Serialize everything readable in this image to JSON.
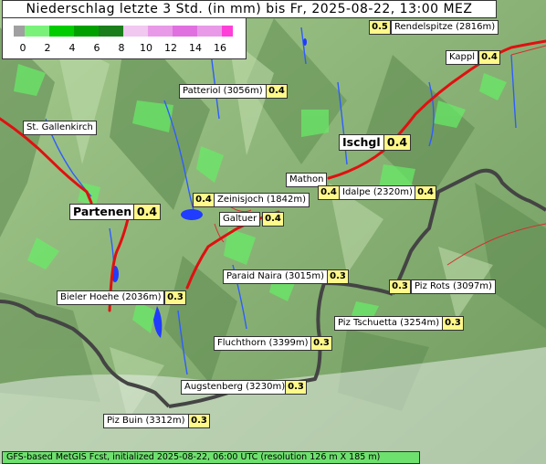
{
  "title": "Niederschlag letzte 3 Std. (in mm) bis Fr, 2025-08-22, 13:00 MEZ",
  "legend": {
    "ticks": [
      "0",
      "2",
      "4",
      "6",
      "8",
      "10",
      "12",
      "14",
      "16"
    ],
    "colors": [
      "#a0a0a0",
      "#7af27a",
      "#00cc00",
      "#00a000",
      "#1a7f1a",
      "#f0c8f0",
      "#e89ae8",
      "#e070e0",
      "#ff3fd8"
    ]
  },
  "places": [
    {
      "name": "Rendelspitze (2816m)",
      "value": "0.5"
    },
    {
      "name": "Kappl",
      "value": "0.4"
    },
    {
      "name": "Patteriol (3056m)",
      "value": "0.4"
    },
    {
      "name": "St. Gallenkirch",
      "value": ""
    },
    {
      "name": "Ischgl",
      "value": "0.4"
    },
    {
      "name": "Mathon",
      "value": "0.4"
    },
    {
      "name": "Idalpe (2320m)",
      "value": "0.4"
    },
    {
      "name": "Zeinisjoch (1842m)",
      "value": "0.4"
    },
    {
      "name": "Partenen",
      "value": "0.4"
    },
    {
      "name": "Galtuer",
      "value": "0.4"
    },
    {
      "name": "Paraid Naira (3015m)",
      "value": "0.3"
    },
    {
      "name": "Piz Rots (3097m)",
      "value": "0.3"
    },
    {
      "name": "Bieler Hoehe (2036m)",
      "value": "0.3"
    },
    {
      "name": "Piz Tschuetta (3254m)",
      "value": "0.3"
    },
    {
      "name": "Fluchthorn (3399m)",
      "value": "0.3"
    },
    {
      "name": "Augstenberg (3230m)",
      "value": "0.3"
    },
    {
      "name": "Piz Buin (3312m)",
      "value": "0.3"
    }
  ],
  "footer": "GFS-based MetGIS Fcst, initialized 2025-08-22, 06:00 UTC  (resolution 126 m X 185 m)"
}
